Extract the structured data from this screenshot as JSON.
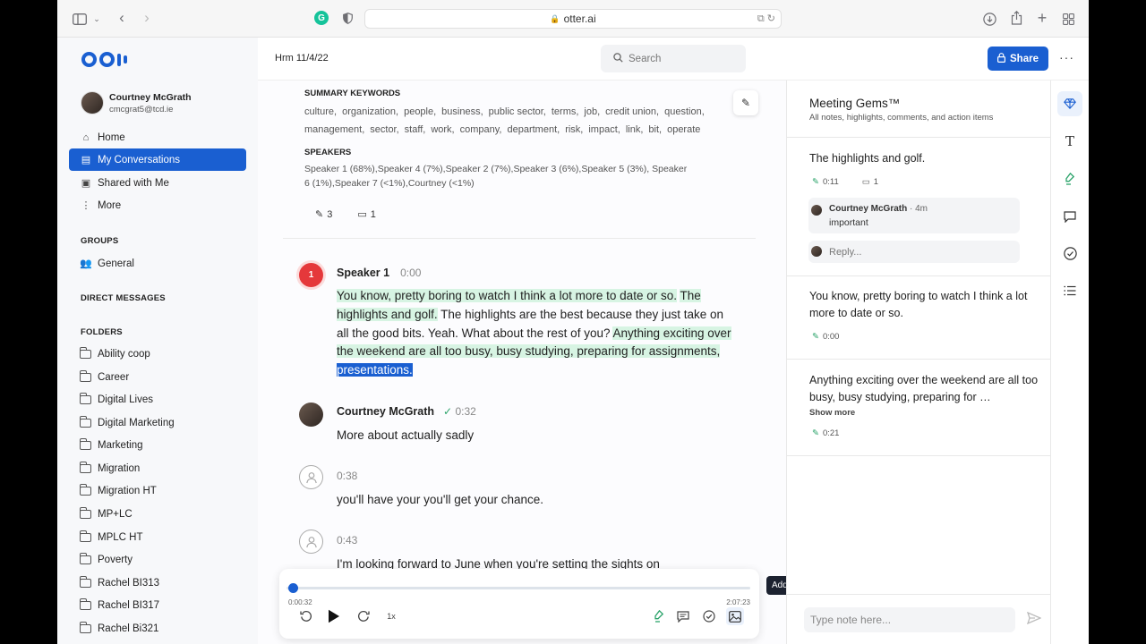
{
  "browser": {
    "url": "otter.ai"
  },
  "sidebar": {
    "user": {
      "name": "Courtney McGrath",
      "email": "cmcgrat5@tcd.ie"
    },
    "nav": [
      {
        "label": "Home",
        "icon": "home-icon"
      },
      {
        "label": "My Conversations",
        "icon": "conversations-icon",
        "active": true
      },
      {
        "label": "Shared with Me",
        "icon": "shared-icon"
      },
      {
        "label": "More",
        "icon": "more-vertical-icon"
      }
    ],
    "groups_heading": "GROUPS",
    "groups": [
      {
        "label": "General"
      }
    ],
    "dm_heading": "DIRECT MESSAGES",
    "folders_heading": "FOLDERS",
    "folders": [
      "Ability coop",
      "Career",
      "Digital Lives",
      "Digital Marketing",
      "Marketing",
      "Migration",
      "Migration HT",
      "MP+LC",
      "MPLC HT",
      "Poverty",
      "Rachel BI313",
      "Rachel BI317",
      "Rachel Bi321"
    ]
  },
  "header": {
    "title": "Hrm 11/4/22",
    "search_placeholder": "Search",
    "share_label": "Share",
    "more_label": "···"
  },
  "summary": {
    "keywords_heading": "SUMMARY KEYWORDS",
    "keywords_row1": [
      "culture,",
      "organization,",
      "people,",
      "business,",
      "public sector,",
      "terms,",
      "job,",
      "credit union,",
      "question,"
    ],
    "keywords_row2": [
      "management,",
      "sector,",
      "staff,",
      "work,",
      "company,",
      "department,",
      "risk,",
      "impact,",
      "link,",
      "bit,",
      "operate"
    ],
    "speakers_heading": "SPEAKERS",
    "speakers_text": "Speaker 1 (68%),Speaker 4 (7%),Speaker 2 (7%),Speaker 3 (6%),Speaker 5 (3%), Speaker 6 (1%),Speaker 7 (<1%),Courtney (<1%)",
    "highlight_count": "3",
    "comment_count": "1"
  },
  "transcript": {
    "block1": {
      "badge": "1",
      "speaker": "Speaker 1",
      "time": "0:00",
      "seg1": "You know, pretty boring to watch I think a lot more to date or so.",
      "seg2": "The highlights and golf.",
      "seg3": " The highlights are the best because they just take on all the good bits. Yeah. What about the rest of you? ",
      "seg4": "Anything exciting over the weekend are all too busy, busy studying, preparing for assignments, ",
      "seg5": "presentations."
    },
    "block2": {
      "speaker": "Courtney McGrath",
      "time": "0:32",
      "text": "More about actually sadly"
    },
    "block3": {
      "time": "0:38",
      "text": "you'll have your you'll get your chance."
    },
    "block4": {
      "time": "0:43",
      "text": "I'm looking forward to June when you're setting the sights on"
    }
  },
  "player": {
    "current": "0:00:32",
    "total": "2:07:23",
    "speed": "1x",
    "progress": 0.004,
    "tooltip": "Add photo"
  },
  "gems": {
    "title": "Meeting Gems™",
    "subtitle": "All notes, highlights, comments, and action items",
    "gem1": {
      "text": "The highlights and golf.",
      "time": "0:11",
      "comments": "1",
      "comment_author": "Courtney McGrath",
      "comment_age": "4m",
      "comment_text": "important",
      "reply_placeholder": "Reply..."
    },
    "gem2": {
      "text": "You know, pretty boring to watch I think a lot more to date or so.",
      "time": "0:00"
    },
    "gem3": {
      "text": "Anything exciting over the weekend are all too busy, busy studying, preparing for …",
      "show_more": "Show more",
      "time": "0:21"
    },
    "note_placeholder": "Type note here..."
  },
  "colors": {
    "accent": "#1a5fd1",
    "highlight": "#d7f4e3",
    "badge_red": "#e5383b"
  }
}
